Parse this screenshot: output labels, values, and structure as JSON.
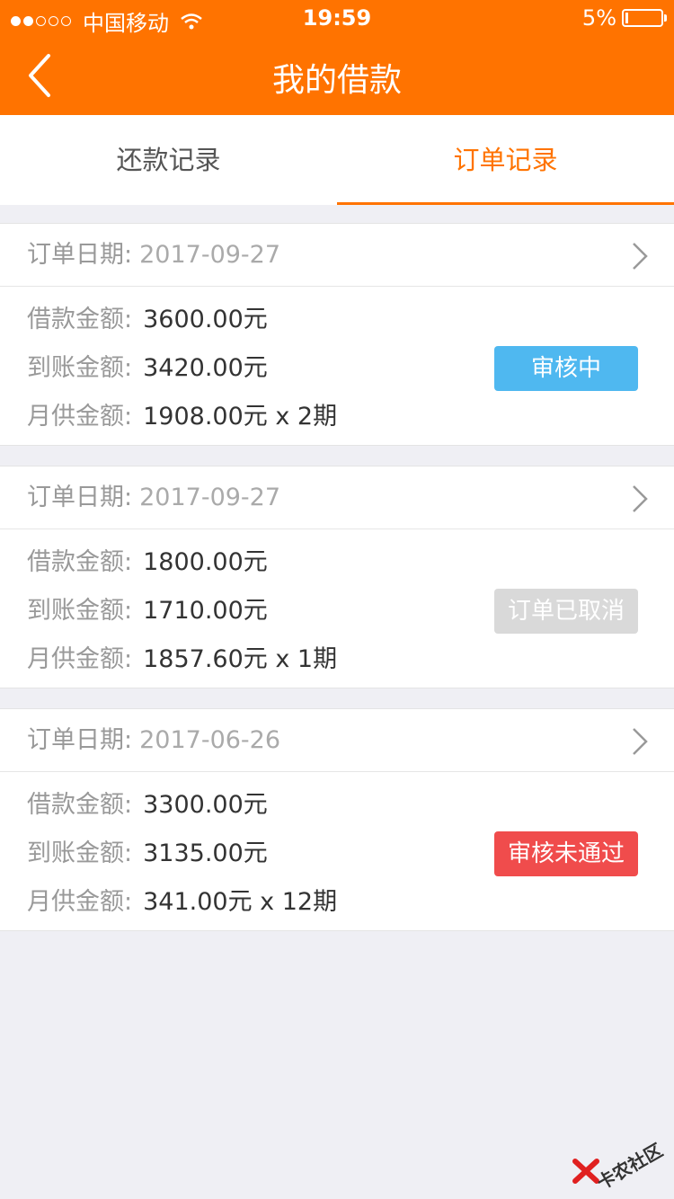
{
  "status_bar": {
    "carrier": "中国移动",
    "time": "19:59",
    "battery": "5%"
  },
  "header": {
    "title": "我的借款",
    "back_icon": "chevron-left-icon"
  },
  "tabs": [
    {
      "label": "还款记录",
      "active": false
    },
    {
      "label": "订单记录",
      "active": true
    }
  ],
  "labels": {
    "order_date": "订单日期:",
    "loan_amount": "借款金额:",
    "received_amount": "到账金额:",
    "monthly_payment": "月供金额:"
  },
  "orders": [
    {
      "date": "2017-09-27",
      "loan_amount": "3600.00元",
      "received_amount": "3420.00元",
      "monthly_payment": "1908.00元 x 2期",
      "status": "审核中",
      "status_color": "#4fb8f0"
    },
    {
      "date": "2017-09-27",
      "loan_amount": "1800.00元",
      "received_amount": "1710.00元",
      "monthly_payment": "1857.60元 x 1期",
      "status": "订单已取消",
      "status_color": "#d9d9d9"
    },
    {
      "date": "2017-06-26",
      "loan_amount": "3300.00元",
      "received_amount": "3135.00元",
      "monthly_payment": "341.00元 x 12期",
      "status": "审核未通过",
      "status_color": "#f04c4c"
    }
  ],
  "watermark": {
    "text": "卡农社区"
  },
  "colors": {
    "brand": "#ff7300",
    "background": "#efeff4"
  }
}
